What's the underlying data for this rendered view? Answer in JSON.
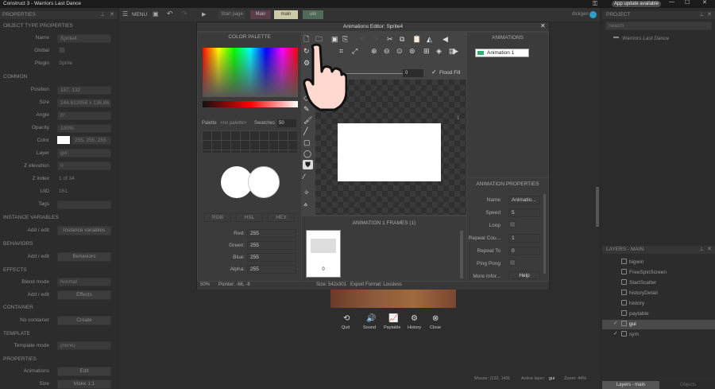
{
  "title_bar": {
    "title": "Construct 3 - Warriors Last Dance",
    "update_label": "App update available"
  },
  "menu_bar": {
    "menu_label": "MENU",
    "tabs": [
      "Start page",
      "Main",
      "main",
      "ulo"
    ],
    "user": "dickgen"
  },
  "properties": {
    "header": "PROPERTIES",
    "sections": {
      "otp": "OBJECT TYPE PROPERTIES",
      "common": "COMMON",
      "instvars": "INSTANCE VARIABLES",
      "behaviors": "BEHAVIORS",
      "effects": "EFFECTS",
      "container": "CONTAINER",
      "template": "TEMPLATE",
      "props": "PROPERTIES"
    },
    "labels": {
      "name": "Name",
      "global": "Global",
      "plugin": "Plugin",
      "position": "Position",
      "size": "Size",
      "angle": "Angle",
      "opacity": "Opacity",
      "color": "Color",
      "layer": "Layer",
      "zelev": "Z elevation",
      "zindex": "Z index",
      "uid": "UID",
      "tags": "Tags",
      "addedit": "Add / edit",
      "blendmode": "Blend mode",
      "nocontainer": "No container",
      "templatemode": "Template mode",
      "animations": "Animations",
      "size2": "Size"
    },
    "values": {
      "name": "Sprite4",
      "plugin": "Sprite",
      "position": "157, 132",
      "size": "244.612056 x 136.86...",
      "angle": "0°",
      "opacity": "100%",
      "color": "255, 255, 255",
      "layer": "gui",
      "zelev": "0",
      "zindex": "1 of 34",
      "uid": "161",
      "instvars_btn": "Instance variables",
      "behaviors_btn": "Behaviors",
      "blendmode": "Normal",
      "effects_btn": "Effects",
      "create_btn": "Create",
      "templatemode": "(none)",
      "animations_btn": "Edit",
      "size_btn": "Make 1:1"
    }
  },
  "editor": {
    "title": "Animations Editor: Sprite4",
    "palette": {
      "header": "COLOR PALETTE",
      "palette_label": "Palette",
      "palette_value": "<no palette>",
      "swatches_label": "Swatches",
      "swatches_value": "50",
      "modes": [
        "RGB",
        "HSL",
        "HEX"
      ],
      "red_label": "Red:",
      "red": "255",
      "green_label": "Green:",
      "green": "255",
      "blue_label": "Blue:",
      "blue": "255",
      "alpha_label": "Alpha:",
      "alpha": "255"
    },
    "canvas": {
      "flood_value": "0",
      "flood_label": "Flood Fill",
      "corner_number": "1"
    },
    "frames": {
      "header": "ANIMATION 1 FRAMES (1)",
      "frame_number": "0"
    },
    "animations": {
      "header": "ANIMATIONS",
      "items": [
        "Animation 1"
      ]
    },
    "anim_props": {
      "header": "ANIMATION PROPERTIES",
      "name_label": "Name",
      "name": "Animatio...",
      "speed_label": "Speed",
      "speed": "5",
      "loop_label": "Loop",
      "repeat_count_label": "Repeat Cou...",
      "repeat_count": "1",
      "repeat_to_label": "Repeat To",
      "repeat_to": "0",
      "pingpong_label": "Ping Pong",
      "more_label": "More Infor...",
      "help_btn": "Help"
    },
    "status": {
      "zoom": "50%",
      "pointer": "Pointer: -66, -8",
      "size": "Size: 542x301",
      "export": "Export Format: Lossless"
    }
  },
  "layout": {
    "icons": [
      "Quit",
      "Sound",
      "Paytable",
      "History",
      "Close"
    ]
  },
  "statusbar": {
    "mouse": "Mouse: (132, 149)",
    "active_layer_label": "Active layer:",
    "active_layer": "gui",
    "zoom": "Zoom: 44%"
  },
  "project": {
    "header": "PROJECT",
    "search_placeholder": "Search",
    "root": "Warriors Last Dance"
  },
  "layers": {
    "header": "LAYERS - MAIN",
    "items": [
      "bigwin",
      "FreeSpinScreen",
      "StartScatter",
      "historyDetail",
      "history",
      "paytable",
      "gui",
      "sym"
    ],
    "tab1": "Layers - main",
    "tab2": "Objects"
  }
}
